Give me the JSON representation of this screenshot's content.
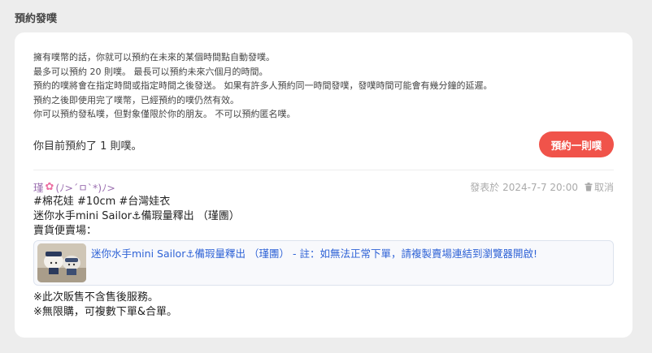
{
  "page": {
    "title": "預約發噗"
  },
  "notes": [
    "擁有噗幣的話，你就可以預約在未來的某個時間點自動發噗。",
    "最多可以預約 20 則噗。 最長可以預約未來六個月的時間。",
    "預約的噗將會在指定時間或指定時間之後發送。 如果有許多人預約同一時間發噗，發噗時間可能會有幾分鐘的延遲。",
    "預約之後即使用完了噗幣，已經預約的噗仍然有效。",
    "你可以預約發私噗，但對象僅限於你的朋友。 不可以預約匿名噗。"
  ],
  "scheduled": {
    "count_text": "你目前預約了 1 則噗。",
    "button_label": "預約一則噗"
  },
  "post": {
    "author_prefix": "瑾",
    "author_flower": "✿",
    "author_suffix": "(ﾉ>´ㅁ`*)ﾉ>",
    "meta_prefix": "發表於",
    "timestamp": "2024-7-7 20:00",
    "cancel_label": "取消",
    "body_lines": [
      "#棉花娃 #10cm #台灣娃衣",
      "迷你水手mini Sailor⚓備瑕量釋出 （瑾團）",
      "賣貨便賣場："
    ],
    "link_text": "迷你水手mini Sailor⚓備瑕量釋出 （瑾團） - 註：如無法正常下單，請複製賣場連結到瀏覽器開啟!",
    "footer_lines": [
      "※此次販售不含售後服務。",
      "※無限購，可複數下單&合單。"
    ]
  },
  "colors": {
    "accent": "#f0534a",
    "link": "#2f63d6",
    "author": "#9b6fb0",
    "background": "#ededed"
  },
  "icons": {
    "cancel": "trash-icon",
    "author_decoration": "flower-icon"
  }
}
